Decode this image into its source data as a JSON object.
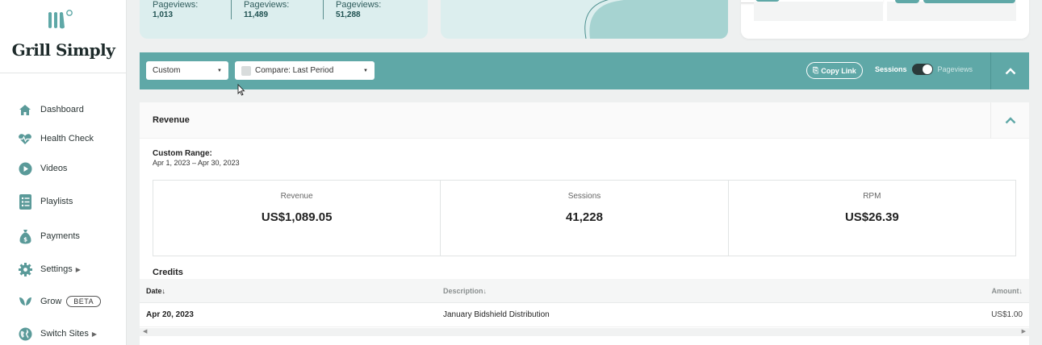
{
  "sidebar": {
    "site_name": "Grill Simply",
    "items": [
      {
        "label": "Dashboard",
        "icon": "home-icon"
      },
      {
        "label": "Health Check",
        "icon": "heartbeat-icon"
      },
      {
        "label": "Videos",
        "icon": "play-circle-icon"
      },
      {
        "label": "Playlists",
        "icon": "list-icon"
      },
      {
        "label": "Payments",
        "icon": "money-bag-icon"
      },
      {
        "label": "Settings",
        "icon": "gear-icon"
      },
      {
        "label": "Grow",
        "icon": "leaf-icon",
        "badge": "BETA"
      },
      {
        "label": "Switch Sites",
        "icon": "globe-icon"
      }
    ]
  },
  "top_stats": [
    {
      "label": "Pageviews:",
      "value": "1,013"
    },
    {
      "label": "Pageviews:",
      "value": "11,489"
    },
    {
      "label": "Pageviews:",
      "value": "51,288"
    }
  ],
  "filters": {
    "range_select": "Custom",
    "compare_select": "Compare: Last Period",
    "copy_link": "Copy Link",
    "toggle_left": "Sessions",
    "toggle_right": "Pageviews"
  },
  "revenue": {
    "title": "Revenue",
    "range_label": "Custom Range:",
    "range_value": "Apr 1, 2023 – Apr 30, 2023",
    "stats": [
      {
        "label": "Revenue",
        "value": "US$1,089.05"
      },
      {
        "label": "Sessions",
        "value": "41,228"
      },
      {
        "label": "RPM",
        "value": "US$26.39"
      }
    ],
    "credits_title": "Credits",
    "columns": {
      "date": "Date↓",
      "description": "Description↓",
      "amount": "Amount↓"
    },
    "rows": [
      {
        "date": "Apr 20, 2023",
        "description": "January Bidshield Distribution",
        "amount": "US$1.00"
      }
    ]
  },
  "colors": {
    "accent": "#5fa8a7",
    "light_accent": "#dceeee"
  }
}
